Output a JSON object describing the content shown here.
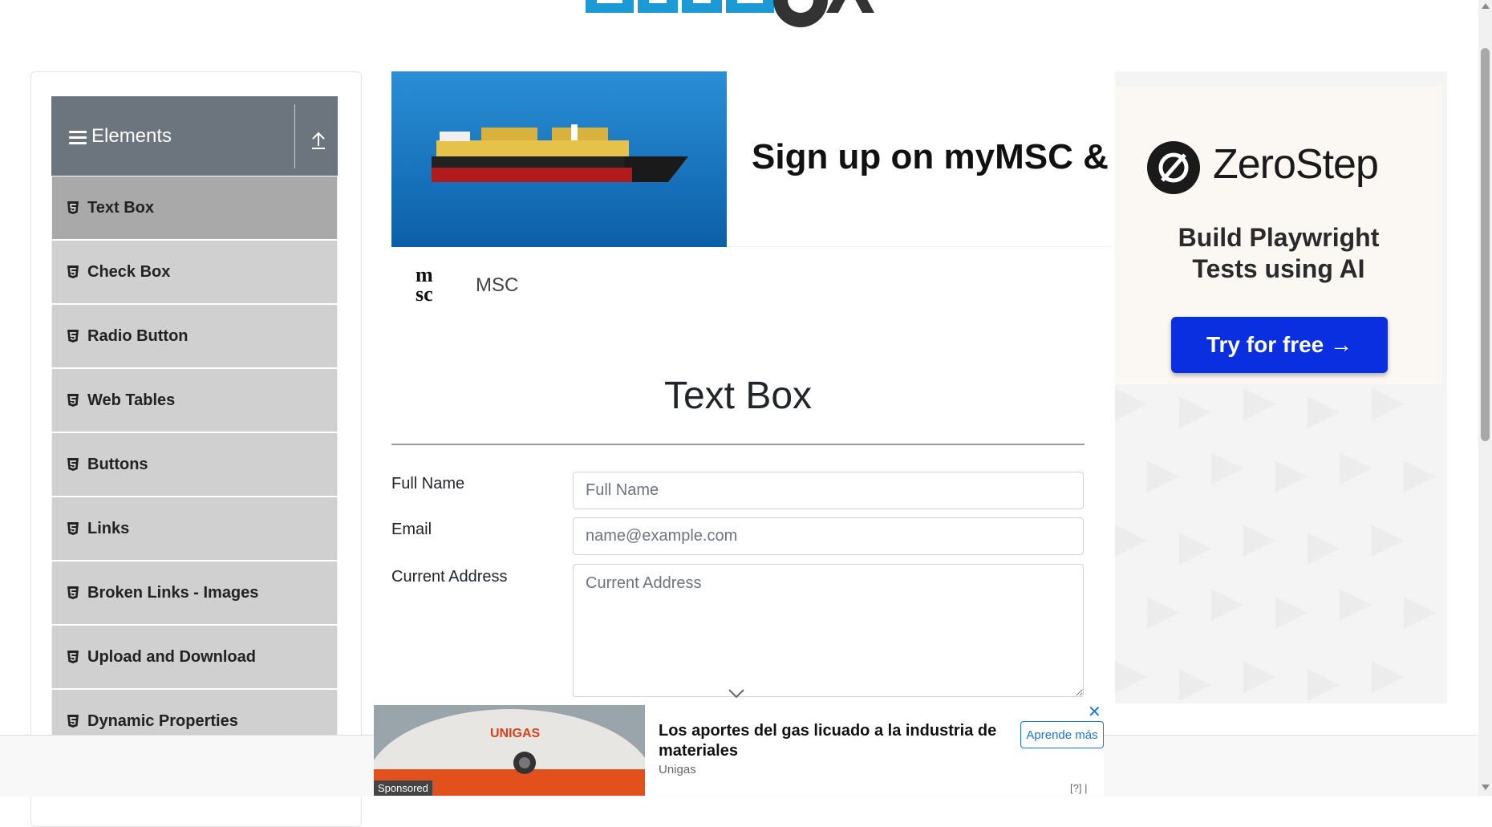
{
  "header": {
    "logo_icon": "toolsqa-logo"
  },
  "sidebar": {
    "group_title": "Elements",
    "group_icon": "hamburger-icon",
    "collapse_icon": "upload-arrow-icon",
    "items": [
      {
        "label": "Text Box",
        "active": true
      },
      {
        "label": "Check Box"
      },
      {
        "label": "Radio Button"
      },
      {
        "label": "Web Tables"
      },
      {
        "label": "Buttons"
      },
      {
        "label": "Links"
      },
      {
        "label": "Broken Links - Images"
      },
      {
        "label": "Upload and Download"
      },
      {
        "label": "Dynamic Properties"
      }
    ]
  },
  "ad_top": {
    "headline": "Sign up on myMSC & B",
    "advertiser": "MSC"
  },
  "form": {
    "title": "Text Box",
    "full_name": {
      "label": "Full Name",
      "placeholder": "Full Name"
    },
    "email": {
      "label": "Email",
      "placeholder": "name@example.com"
    },
    "address": {
      "label": "Current Address",
      "placeholder": "Current Address"
    }
  },
  "ad_right": {
    "brand": "ZeroStep",
    "tagline_1": "Build Playwright",
    "tagline_2": "Tests using AI",
    "button": "Try for free →",
    "close": "✕"
  },
  "ad_bottom": {
    "headline": "Los aportes del gas licuado a la industria de materiales",
    "brand": "Unigas",
    "tank_text": "UNIGAS",
    "button": "Aprende más",
    "sponsored": "Sponsored",
    "info": "[?] |",
    "close": "✕"
  },
  "colors": {
    "sidebar_header": "#6c757d",
    "menu_item": "#d0d0d0",
    "menu_active": "#a9a9a9",
    "cta_blue": "#0a2fe0",
    "link_blue": "#1a73e8"
  }
}
